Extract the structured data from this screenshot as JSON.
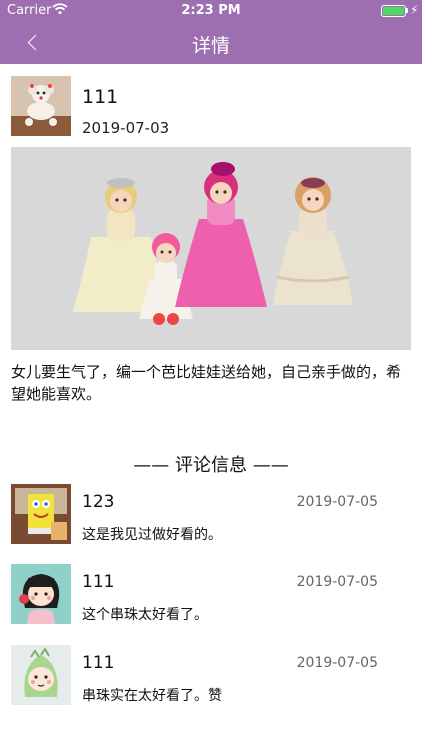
{
  "status_bar": {
    "carrier": "Carrier",
    "time": "2:23 PM",
    "battery_percent": 100,
    "icons": [
      "wifi-icon",
      "battery-icon",
      "charging-bolt-icon"
    ]
  },
  "nav": {
    "title": "详情",
    "back_icon": "chevron-left-icon",
    "bar_color": "#9d6fb0"
  },
  "post": {
    "author": "111",
    "date": "2019-07-03",
    "text": "女儿要生气了，编一个芭比娃娃送给她，自己亲手做的，希望她能喜欢。",
    "avatar": "beaded-poodle-avatar",
    "image": "beaded-dolls-photo"
  },
  "comments_section": {
    "title": "—— 评论信息 ——"
  },
  "comments": [
    {
      "name": "123",
      "date": "2019-07-05",
      "text": "这是我见过做好看的。",
      "avatar": "beaded-spongebob-avatar"
    },
    {
      "name": "111",
      "date": "2019-07-05",
      "text": "这个串珠太好看了。",
      "avatar": "girl-cartoon-avatar"
    },
    {
      "name": "111",
      "date": "2019-07-05",
      "text": "串珠实在太好看了。赞",
      "avatar": "dino-cartoon-avatar"
    }
  ]
}
